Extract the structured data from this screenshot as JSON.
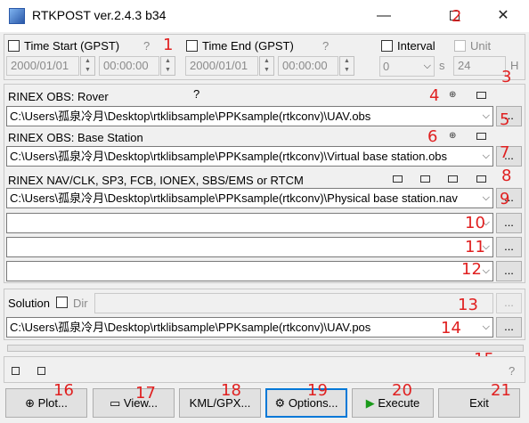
{
  "window": {
    "title": "RTKPOST ver.2.4.3 b34",
    "minimize": "—",
    "close": "✕"
  },
  "time_start": {
    "label": "Time Start (GPST)",
    "help": "?",
    "date": "2000/01/01",
    "time": "00:00:00"
  },
  "time_end": {
    "label": "Time End (GPST)",
    "help": "?",
    "date": "2000/01/01",
    "time": "00:00:00"
  },
  "interval": {
    "label": "Interval",
    "value": "0",
    "unit": "s"
  },
  "unit": {
    "label": "Unit",
    "value": "24",
    "unit": "H"
  },
  "rover": {
    "label": "RINEX OBS: Rover",
    "help": "?",
    "path": "C:\\Users\\孤泉冷月\\Desktop\\rtklibsample\\PPKsample(rtkconv)\\UAV.obs",
    "browse": "..."
  },
  "base": {
    "label": "RINEX OBS: Base Station",
    "path": "C:\\Users\\孤泉冷月\\Desktop\\rtklibsample\\PPKsample(rtkconv)\\Virtual base station.obs",
    "browse": "..."
  },
  "nav": {
    "label": "RINEX NAV/CLK, SP3, FCB, IONEX, SBS/EMS  or RTCM",
    "files": [
      "C:\\Users\\孤泉冷月\\Desktop\\rtklibsample\\PPKsample(rtkconv)\\Physical base station.nav",
      "",
      "",
      ""
    ],
    "browse": "..."
  },
  "solution": {
    "label": "Solution",
    "dir_label": "Dir",
    "dir_value": "",
    "path": "C:\\Users\\孤泉冷月\\Desktop\\rtklibsample\\PPKsample(rtkconv)\\UAV.pos",
    "browse": "..."
  },
  "status": {
    "help": "?"
  },
  "buttons": {
    "plot": "Plot...",
    "view": "View...",
    "kml": "KML/GPX...",
    "options": "Options...",
    "execute": "Execute",
    "exit": "Exit"
  },
  "annotations": [
    "1",
    "2",
    "3",
    "4",
    "5",
    "6",
    "7",
    "8",
    "9",
    "10",
    "11",
    "12",
    "13",
    "14",
    "15",
    "16",
    "17",
    "18",
    "19",
    "20",
    "21"
  ],
  "colors": {
    "annotation": "#e02020",
    "focus": "#0078d7",
    "execute_icon": "#1a9a1a"
  },
  "progress": 0
}
